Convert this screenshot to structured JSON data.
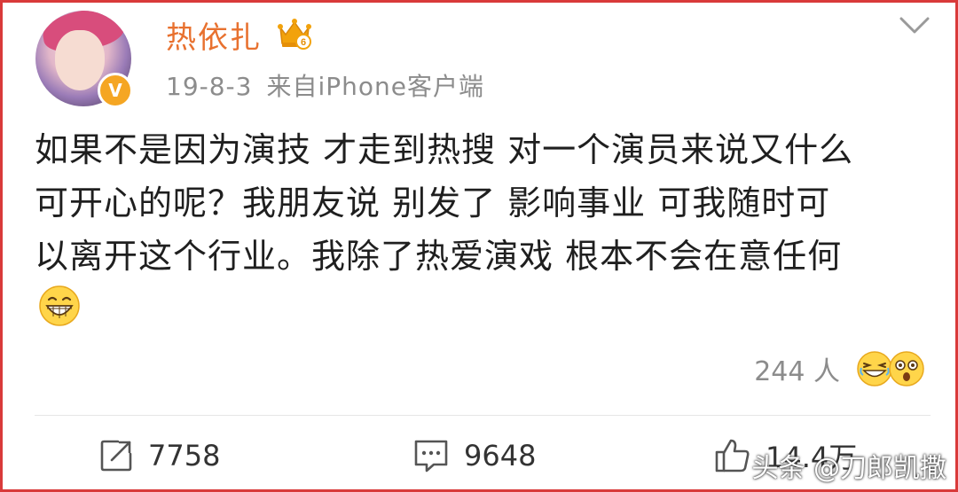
{
  "post": {
    "author": {
      "name": "热依扎",
      "avatar_icon": "profile-photo",
      "verified_icon": "verified-badge-icon",
      "verified_mark": "V",
      "crown_icon": "crown-vip-icon",
      "crown_level": "6"
    },
    "date": "19-8-3",
    "source": "来自iPhone客户端",
    "content_lines": [
      "如果不是因为演技 才走到热搜 对一个演员来说又什么",
      "可开心的呢？我朋友说 别发了 影响事业 可我随时可",
      "以离开这个行业。我除了热爱演戏 根本不会在意任何"
    ],
    "content_emoji": "grinning-face-icon",
    "reactions": {
      "count": "244 人",
      "emojis": [
        "laughing-face-icon",
        "shocked-face-icon"
      ]
    },
    "actions": {
      "repost": {
        "icon": "repost-icon",
        "count": "7758"
      },
      "comment": {
        "icon": "comment-icon",
        "count": "9648"
      },
      "like": {
        "icon": "thumbs-up-icon",
        "count": "14.4万"
      }
    }
  },
  "watermark": "头条 @刀郎凯撒",
  "colors": {
    "border": "#d93a3a",
    "username": "#e8712f",
    "meta": "#8c8c8c",
    "text": "#1f1f1f"
  }
}
